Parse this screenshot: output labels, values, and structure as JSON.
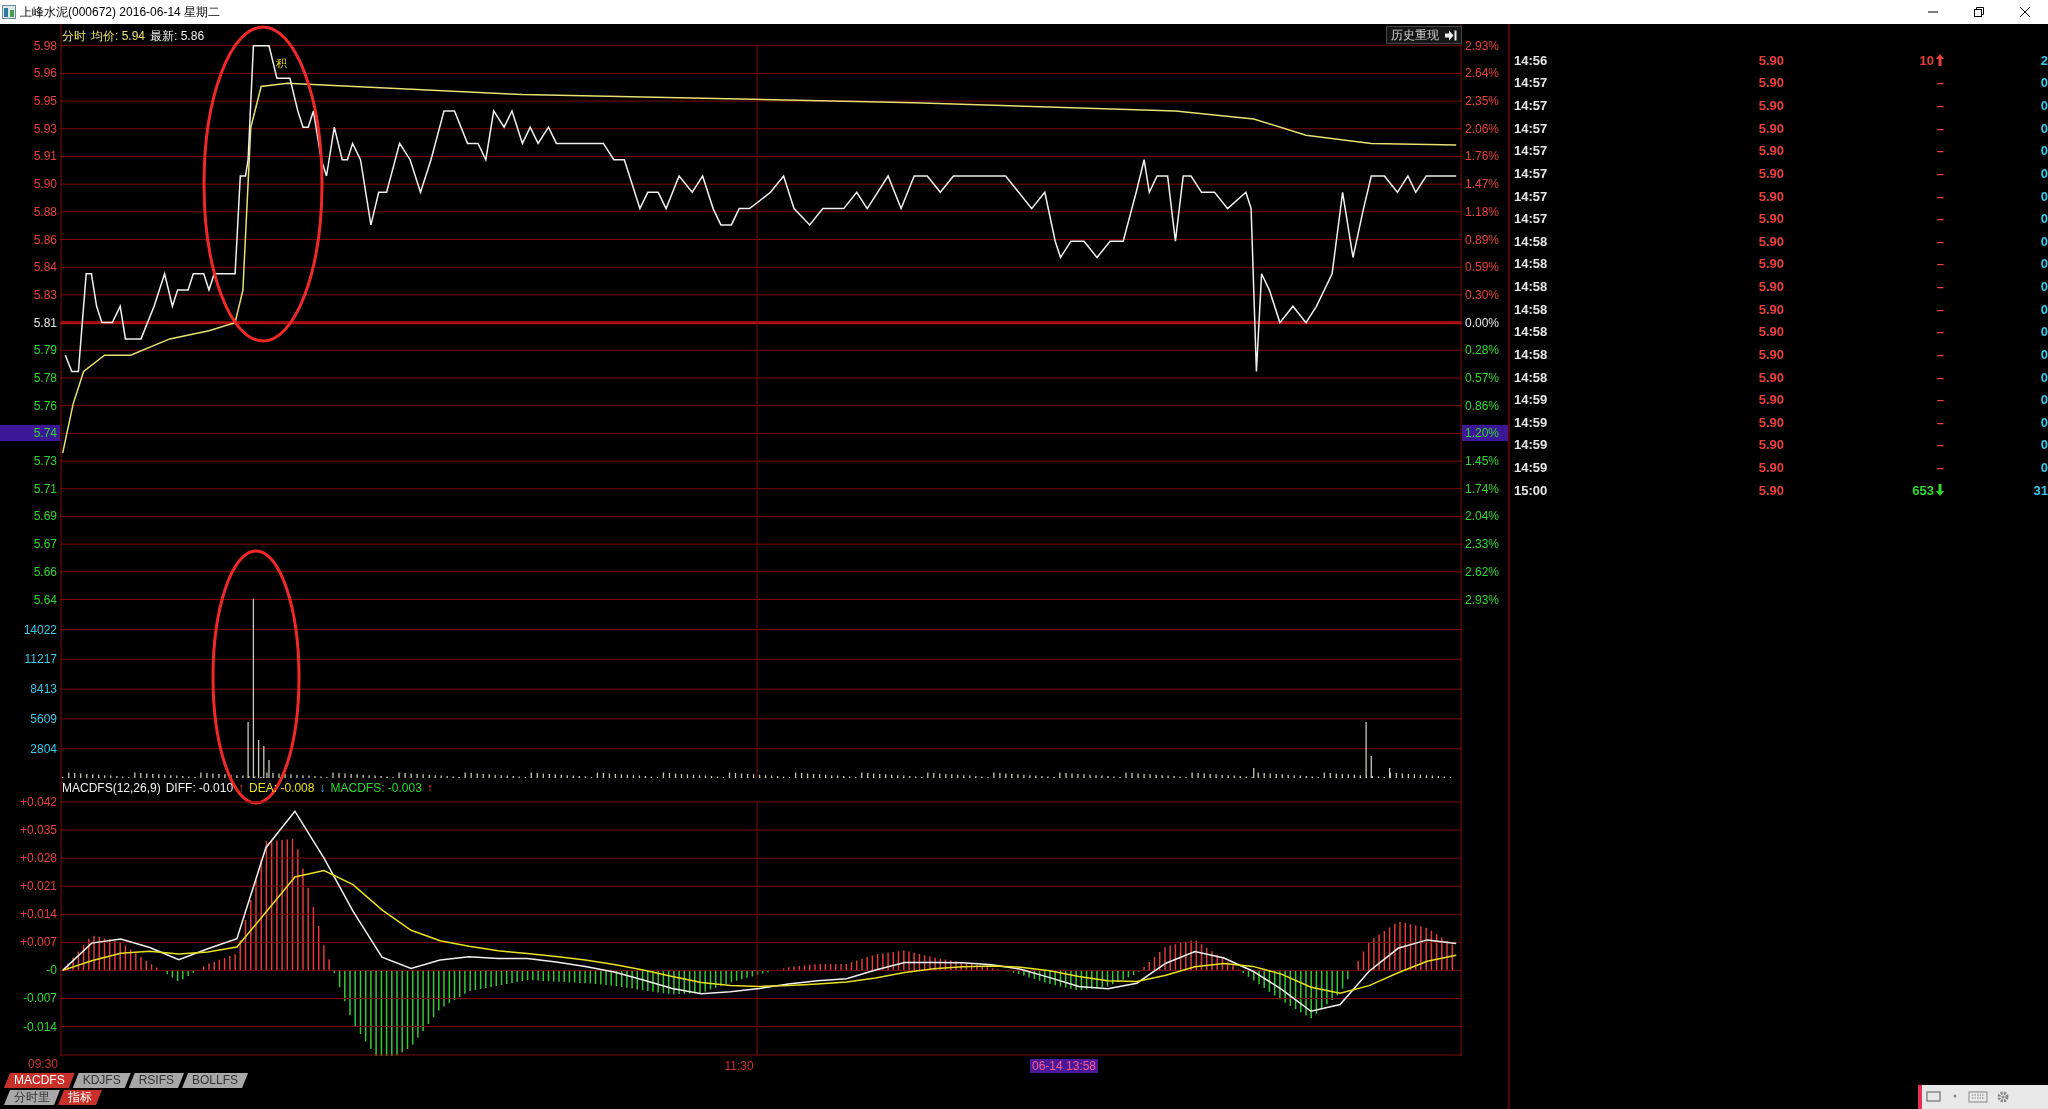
{
  "window": {
    "title": "上峰水泥(000672) 2016-06-14 星期二"
  },
  "chart_header": {
    "mode": "分时",
    "average": "均价: 5.94",
    "latest": "最新: 5.86"
  },
  "history_button": {
    "label": "历史重现"
  },
  "chart_mark": "积",
  "price_axis": [
    {
      "label": "5.98",
      "kind": "up",
      "highlighted": false
    },
    {
      "label": "5.96",
      "kind": "up",
      "highlighted": false
    },
    {
      "label": "5.95",
      "kind": "up",
      "highlighted": false
    },
    {
      "label": "5.93",
      "kind": "up",
      "highlighted": false
    },
    {
      "label": "5.91",
      "kind": "up",
      "highlighted": false
    },
    {
      "label": "5.90",
      "kind": "up",
      "highlighted": false
    },
    {
      "label": "5.88",
      "kind": "up",
      "highlighted": false
    },
    {
      "label": "5.86",
      "kind": "up",
      "highlighted": false
    },
    {
      "label": "5.84",
      "kind": "up",
      "highlighted": false
    },
    {
      "label": "5.83",
      "kind": "up",
      "highlighted": false
    },
    {
      "label": "5.81",
      "kind": "flat",
      "highlighted": false
    },
    {
      "label": "5.79",
      "kind": "down",
      "highlighted": false
    },
    {
      "label": "5.78",
      "kind": "down",
      "highlighted": false
    },
    {
      "label": "5.76",
      "kind": "down",
      "highlighted": false
    },
    {
      "label": "5.74",
      "kind": "down",
      "highlighted": true
    },
    {
      "label": "5.73",
      "kind": "down",
      "highlighted": false
    },
    {
      "label": "5.71",
      "kind": "down",
      "highlighted": false
    },
    {
      "label": "5.69",
      "kind": "down",
      "highlighted": false
    },
    {
      "label": "5.67",
      "kind": "down",
      "highlighted": false
    },
    {
      "label": "5.66",
      "kind": "down",
      "highlighted": false
    },
    {
      "label": "5.64",
      "kind": "down",
      "highlighted": false
    }
  ],
  "percent_axis": [
    {
      "label": "2.93%",
      "kind": "up",
      "highlighted": false
    },
    {
      "label": "2.64%",
      "kind": "up",
      "highlighted": false
    },
    {
      "label": "2.35%",
      "kind": "up",
      "highlighted": false
    },
    {
      "label": "2.06%",
      "kind": "up",
      "highlighted": false
    },
    {
      "label": "1.76%",
      "kind": "up",
      "highlighted": false
    },
    {
      "label": "1.47%",
      "kind": "up",
      "highlighted": false
    },
    {
      "label": "1.18%",
      "kind": "up",
      "highlighted": false
    },
    {
      "label": "0.89%",
      "kind": "up",
      "highlighted": false
    },
    {
      "label": "0.59%",
      "kind": "up",
      "highlighted": false
    },
    {
      "label": "0.30%",
      "kind": "up",
      "highlighted": false
    },
    {
      "label": "0.00%",
      "kind": "flat",
      "highlighted": false
    },
    {
      "label": "0.28%",
      "kind": "down",
      "highlighted": false
    },
    {
      "label": "0.57%",
      "kind": "down",
      "highlighted": false
    },
    {
      "label": "0.86%",
      "kind": "down",
      "highlighted": false
    },
    {
      "label": "1.20%",
      "kind": "down",
      "highlighted": true
    },
    {
      "label": "1.45%",
      "kind": "down",
      "highlighted": false
    },
    {
      "label": "1.74%",
      "kind": "down",
      "highlighted": false
    },
    {
      "label": "2.04%",
      "kind": "down",
      "highlighted": false
    },
    {
      "label": "2.33%",
      "kind": "down",
      "highlighted": false
    },
    {
      "label": "2.62%",
      "kind": "down",
      "highlighted": false
    },
    {
      "label": "2.93%",
      "kind": "down",
      "highlighted": false
    }
  ],
  "volume_axis": [
    "14022",
    "11217",
    "8413",
    "5609",
    "2804"
  ],
  "macd_header": {
    "name": "MACDFS(12,26,9)",
    "diff": ": -0.010",
    "diff_arrow": "↑",
    "dea": ": -0.008",
    "dea_arrow": "↓",
    "macd": "MACDFS: -0.003",
    "macd_arrow": "↑"
  },
  "macd_chart": {
    "chart_data": {
      "type": "line",
      "grid": true,
      "ylim": [
        -0.021,
        0.042
      ],
      "yticks": [
        {
          "value": 0.042,
          "label": "+0.042"
        },
        {
          "value": 0.035,
          "label": "+0.035"
        },
        {
          "value": 0.028,
          "label": "+0.028"
        },
        {
          "value": 0.021,
          "label": "+0.021"
        },
        {
          "value": 0.014,
          "label": "+0.014"
        },
        {
          "value": 0.007,
          "label": "+0.007"
        },
        {
          "value": 0,
          "label": "-0"
        },
        {
          "value": -0.007,
          "label": "-0.007"
        },
        {
          "value": -0.014,
          "label": "-0.014"
        }
      ],
      "series": [
        {
          "name": "DIFF",
          "color": "#f0f0f0",
          "values": [
            0,
            0.0068,
            0.0078,
            0.0057,
            0.0027,
            0.0054,
            0.0079,
            0.0306,
            0.0397,
            0.028,
            0.0148,
            0.0033,
            0.0005,
            0.0026,
            0.0034,
            0.003,
            0.003,
            0.0021,
            0.001,
            -0.0004,
            -0.0024,
            -0.0045,
            -0.0058,
            -0.0053,
            -0.0045,
            -0.0034,
            -0.0026,
            -0.0021,
            0.0001,
            0.002,
            0.002,
            0.0019,
            0.0014,
            0.0003,
            -0.0018,
            -0.004,
            -0.0046,
            -0.0032,
            0.0018,
            0.0047,
            0.0031,
            -0.0002,
            -0.0048,
            -0.0102,
            -0.0085,
            -0.0002,
            0.0055,
            0.0076,
            0.0067
          ]
        },
        {
          "name": "DEA",
          "color": "#e8e020",
          "values": [
            0,
            0.0024,
            0.0043,
            0.0048,
            0.0041,
            0.0046,
            0.0058,
            0.0145,
            0.0233,
            0.0249,
            0.0214,
            0.0151,
            0.01,
            0.0074,
            0.006,
            0.0049,
            0.0042,
            0.0035,
            0.0026,
            0.0015,
            0.0001,
            -0.0015,
            -0.003,
            -0.0038,
            -0.004,
            -0.0038,
            -0.0034,
            -0.0029,
            -0.0019,
            -0.0005,
            0.0004,
            0.0009,
            0.0011,
            0.0008,
            -0.0001,
            -0.0015,
            -0.0026,
            -0.0028,
            -0.0012,
            0.0009,
            0.0017,
            0.001,
            -0.001,
            -0.0042,
            -0.0057,
            -0.0038,
            -0.0006,
            0.0023,
            0.0038
          ]
        }
      ]
    }
  },
  "time_axis": {
    "start": "09:30",
    "middle": "11:30",
    "cursor": "06-14 13:58"
  },
  "indicator_tabs": [
    {
      "label": "MACDFS",
      "selected": true
    },
    {
      "label": "KDJFS",
      "selected": false
    },
    {
      "label": "RSIFS",
      "selected": false
    },
    {
      "label": "BOLLFS",
      "selected": false
    }
  ],
  "view_tabs": [
    {
      "label": "分时里",
      "selected": false
    },
    {
      "label": "指标",
      "selected": true
    }
  ],
  "ticks": [
    {
      "time": "14:56",
      "price": "5.90",
      "volume": "10",
      "kind": "up",
      "column_4": "2"
    },
    {
      "time": "14:57",
      "price": "5.90",
      "volume": "–",
      "kind": "flat",
      "column_4": "0"
    },
    {
      "time": "14:57",
      "price": "5.90",
      "volume": "–",
      "kind": "flat",
      "column_4": "0"
    },
    {
      "time": "14:57",
      "price": "5.90",
      "volume": "–",
      "kind": "flat",
      "column_4": "0"
    },
    {
      "time": "14:57",
      "price": "5.90",
      "volume": "–",
      "kind": "flat",
      "column_4": "0"
    },
    {
      "time": "14:57",
      "price": "5.90",
      "volume": "–",
      "kind": "flat",
      "column_4": "0"
    },
    {
      "time": "14:57",
      "price": "5.90",
      "volume": "–",
      "kind": "flat",
      "column_4": "0"
    },
    {
      "time": "14:57",
      "price": "5.90",
      "volume": "–",
      "kind": "flat",
      "column_4": "0"
    },
    {
      "time": "14:58",
      "price": "5.90",
      "volume": "–",
      "kind": "flat",
      "column_4": "0"
    },
    {
      "time": "14:58",
      "price": "5.90",
      "volume": "–",
      "kind": "flat",
      "column_4": "0"
    },
    {
      "time": "14:58",
      "price": "5.90",
      "volume": "–",
      "kind": "flat",
      "column_4": "0"
    },
    {
      "time": "14:58",
      "price": "5.90",
      "volume": "–",
      "kind": "flat",
      "column_4": "0"
    },
    {
      "time": "14:58",
      "price": "5.90",
      "volume": "–",
      "kind": "flat",
      "column_4": "0"
    },
    {
      "time": "14:58",
      "price": "5.90",
      "volume": "–",
      "kind": "flat",
      "column_4": "0"
    },
    {
      "time": "14:58",
      "price": "5.90",
      "volume": "–",
      "kind": "flat",
      "column_4": "0"
    },
    {
      "time": "14:59",
      "price": "5.90",
      "volume": "–",
      "kind": "flat",
      "column_4": "0"
    },
    {
      "time": "14:59",
      "price": "5.90",
      "volume": "–",
      "kind": "flat",
      "column_4": "0"
    },
    {
      "time": "14:59",
      "price": "5.90",
      "volume": "–",
      "kind": "flat",
      "column_4": "0"
    },
    {
      "time": "14:59",
      "price": "5.90",
      "volume": "–",
      "kind": "flat",
      "column_4": "0"
    },
    {
      "time": "15:00",
      "price": "5.90",
      "volume": "653",
      "kind": "down",
      "column_4": "31"
    }
  ]
}
